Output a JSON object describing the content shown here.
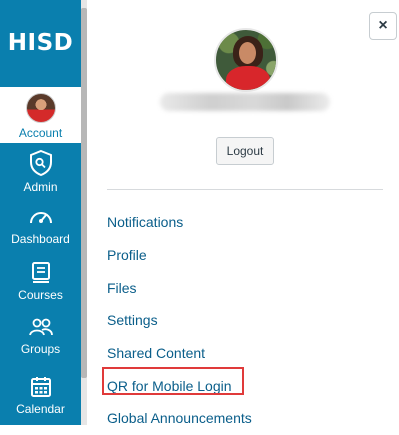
{
  "nav": {
    "logo": "HISD",
    "items": [
      {
        "label": "Account",
        "icon": "avatar-icon"
      },
      {
        "label": "Admin",
        "icon": "shield-icon"
      },
      {
        "label": "Dashboard",
        "icon": "dashboard-icon"
      },
      {
        "label": "Courses",
        "icon": "courses-icon"
      },
      {
        "label": "Groups",
        "icon": "groups-icon"
      },
      {
        "label": "Calendar",
        "icon": "calendar-icon"
      }
    ]
  },
  "tray": {
    "close_label": "×",
    "logout_label": "Logout",
    "menu": [
      "Notifications",
      "Profile",
      "Files",
      "Settings",
      "Shared Content",
      "QR for Mobile Login",
      "Global Announcements"
    ]
  },
  "colors": {
    "nav_bg": "#0a7fae",
    "link": "#0a5e8a",
    "highlight": "#e03a3a"
  }
}
